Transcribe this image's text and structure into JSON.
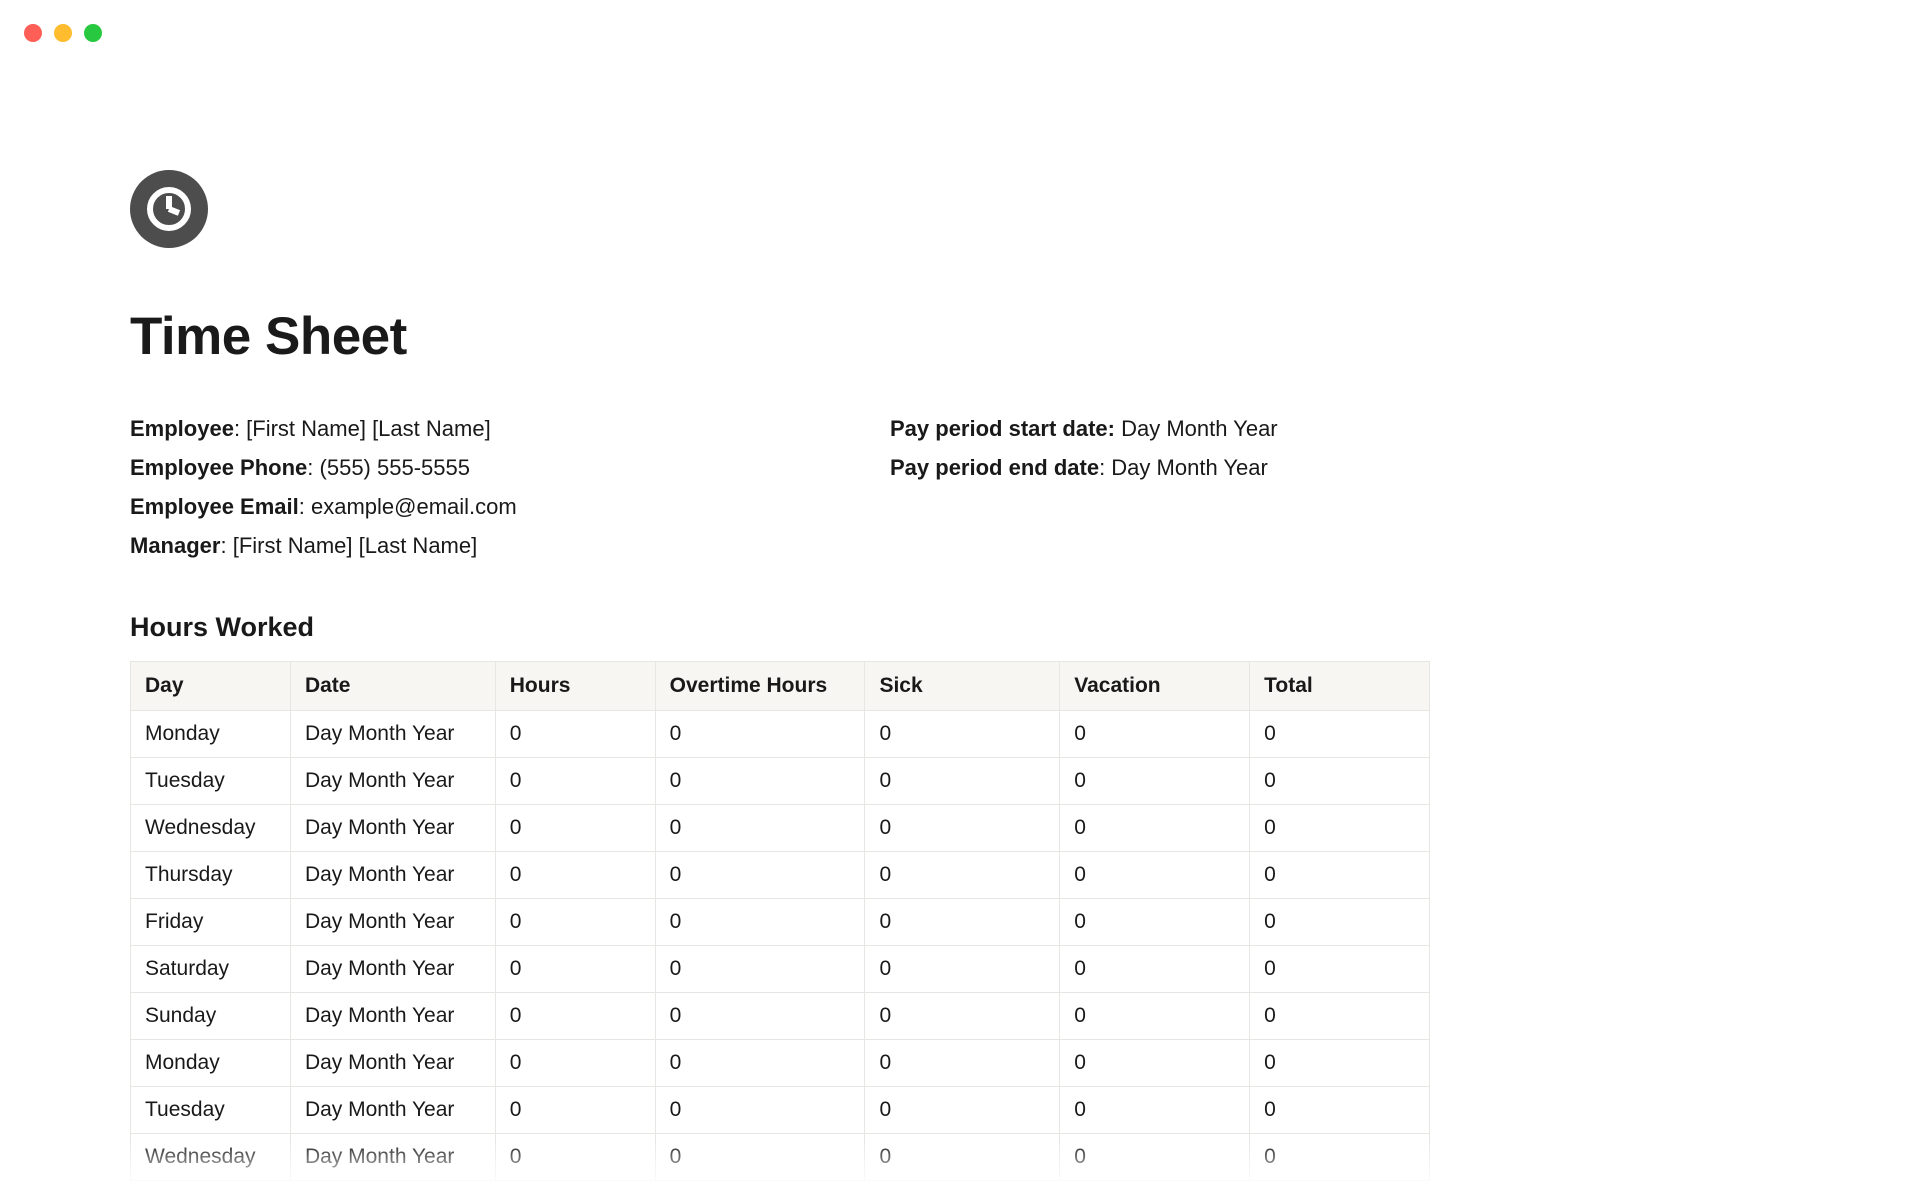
{
  "window": {
    "controls": [
      "close",
      "minimize",
      "zoom"
    ]
  },
  "icon": "clock-icon",
  "title": "Time Sheet",
  "info": {
    "left": [
      {
        "label": "Employee",
        "sep": ": ",
        "value": "[First Name] [Last Name]"
      },
      {
        "label": "Employee Phone",
        "sep": ": ",
        "value": "(555) 555-5555"
      },
      {
        "label": "Employee Email",
        "sep": ": ",
        "value": "example@email.com"
      },
      {
        "label": "Manager",
        "sep": ": ",
        "value": "[First Name] [Last Name]"
      }
    ],
    "right": [
      {
        "label": "Pay period start date:",
        "sep": " ",
        "value": "Day Month Year"
      },
      {
        "label": "Pay period end date",
        "sep": ": ",
        "value": "Day Month Year"
      }
    ]
  },
  "hours_section_title": "Hours Worked",
  "table": {
    "columns": [
      "Day",
      "Date",
      "Hours",
      "Overtime Hours",
      "Sick",
      "Vacation",
      "Total"
    ],
    "rows": [
      {
        "day": "Monday",
        "date": "Day Month Year",
        "hours": "0",
        "overtime": "0",
        "sick": "0",
        "vacation": "0",
        "total": "0"
      },
      {
        "day": "Tuesday",
        "date": "Day Month Year",
        "hours": "0",
        "overtime": "0",
        "sick": "0",
        "vacation": "0",
        "total": "0"
      },
      {
        "day": "Wednesday",
        "date": "Day Month Year",
        "hours": "0",
        "overtime": "0",
        "sick": "0",
        "vacation": "0",
        "total": "0"
      },
      {
        "day": "Thursday",
        "date": "Day Month Year",
        "hours": "0",
        "overtime": "0",
        "sick": "0",
        "vacation": "0",
        "total": "0"
      },
      {
        "day": "Friday",
        "date": "Day Month Year",
        "hours": "0",
        "overtime": "0",
        "sick": "0",
        "vacation": "0",
        "total": "0"
      },
      {
        "day": "Saturday",
        "date": "Day Month Year",
        "hours": "0",
        "overtime": "0",
        "sick": "0",
        "vacation": "0",
        "total": "0"
      },
      {
        "day": "Sunday",
        "date": "Day Month Year",
        "hours": "0",
        "overtime": "0",
        "sick": "0",
        "vacation": "0",
        "total": "0"
      },
      {
        "day": "Monday",
        "date": "Day Month Year",
        "hours": "0",
        "overtime": "0",
        "sick": "0",
        "vacation": "0",
        "total": "0"
      },
      {
        "day": "Tuesday",
        "date": "Day Month Year",
        "hours": "0",
        "overtime": "0",
        "sick": "0",
        "vacation": "0",
        "total": "0"
      },
      {
        "day": "Wednesday",
        "date": "Day Month Year",
        "hours": "0",
        "overtime": "0",
        "sick": "0",
        "vacation": "0",
        "total": "0"
      }
    ]
  }
}
